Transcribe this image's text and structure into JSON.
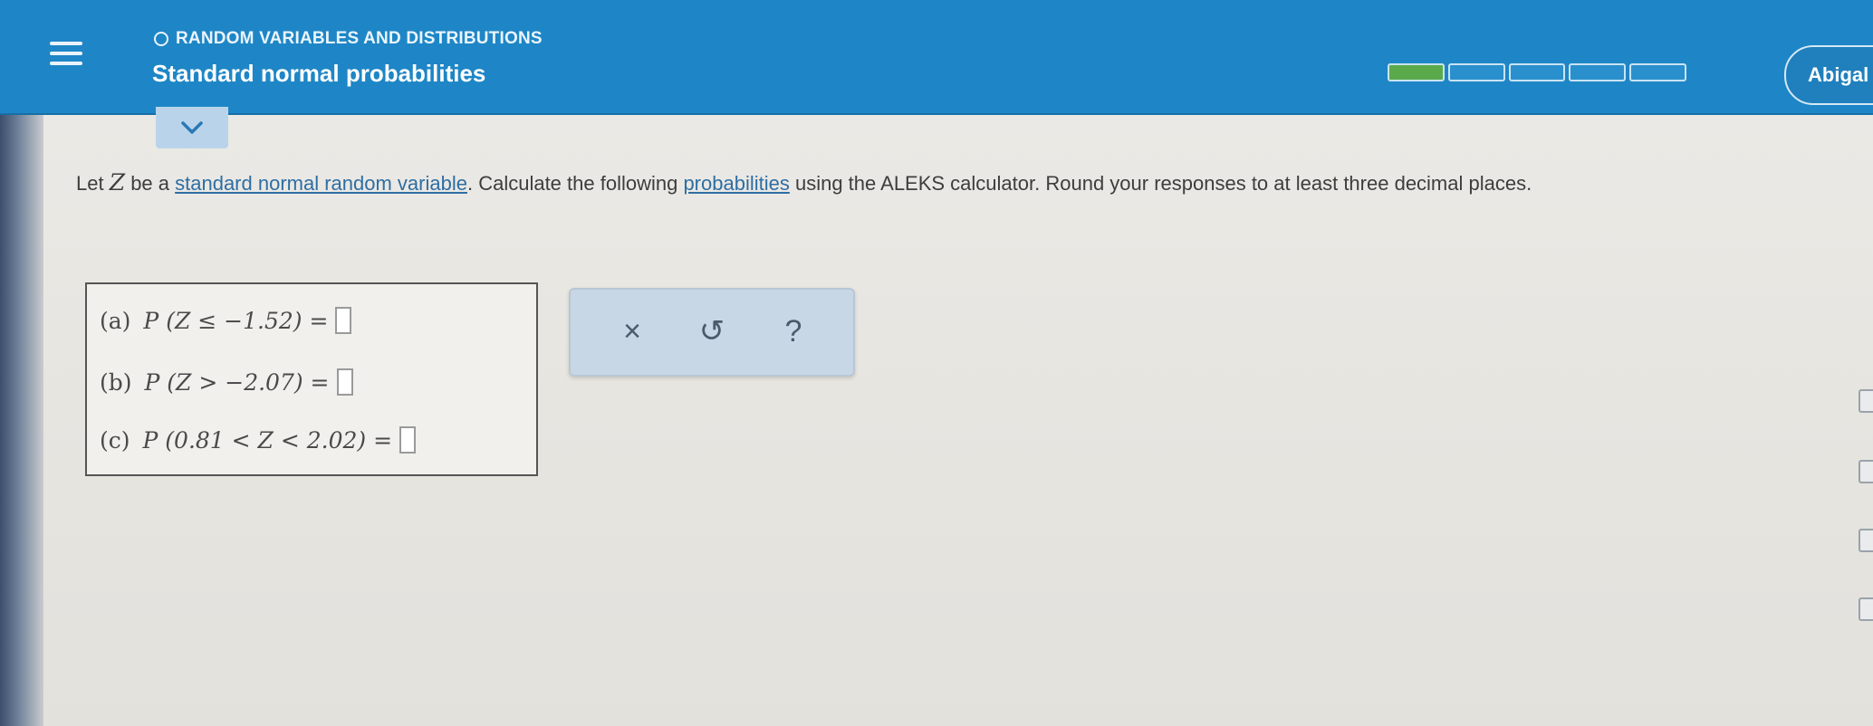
{
  "header": {
    "topic": "RANDOM VARIABLES AND DISTRIBUTIONS",
    "title": "Standard normal probabilities",
    "progress": {
      "filled": 1,
      "total": 5
    },
    "user_name": "Abigal"
  },
  "question": {
    "part1": "Let ",
    "var": "Z",
    "part2": " be a ",
    "link1": "standard normal random variable",
    "part3": ". Calculate the following ",
    "link2": "probabilities",
    "part4": " using the ALEKS calculator. Round your responses to at least three decimal places."
  },
  "parts": [
    {
      "label": "(a)",
      "expr": "P (Z ≤ −1.52) ="
    },
    {
      "label": "(b)",
      "expr": "P (Z > −2.07) ="
    },
    {
      "label": "(c)",
      "expr": "P (0.81 < Z < 2.02) ="
    }
  ],
  "actions": {
    "clear_glyph": "×",
    "undo_glyph": "↺",
    "help_glyph": "?"
  },
  "colors": {
    "header": "#1e86c6",
    "progress_filled": "#5aaa4b",
    "link": "#2e6ea3"
  },
  "icons": [
    "menu-icon",
    "chevron-down-icon",
    "circle-icon",
    "close-icon",
    "undo-icon",
    "help-icon"
  ]
}
